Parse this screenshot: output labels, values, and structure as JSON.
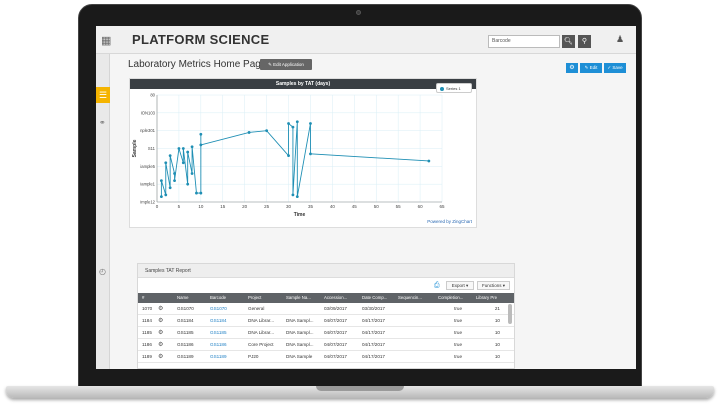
{
  "app": {
    "logo_text": "PLATFORM",
    "logo_text2": "SCIENCE",
    "search_placeholder": "Barcode",
    "page_title": "Laboratory Metrics Home Page",
    "edit_app_label": "✎ Edit Application",
    "edit_label": "✎ Edit",
    "save_label": "✓ Save"
  },
  "chart_data": {
    "type": "line",
    "title": "Samples by TAT (days)",
    "xlabel": "Time",
    "ylabel": "Sample",
    "x_ticks": [
      0,
      5,
      10,
      15,
      20,
      25,
      30,
      35,
      40,
      45,
      50,
      55,
      60,
      65
    ],
    "xlim": [
      0,
      65
    ],
    "y_ticks": [
      "imple12",
      "iample1",
      "iample5",
      "S11",
      "nple301",
      "ION103",
      "80"
    ],
    "ylim": [
      0,
      6
    ],
    "series": [
      {
        "name": "Series 1",
        "color": "#1f8fb4",
        "x": [
          1,
          1,
          2,
          2,
          3,
          3,
          4,
          4,
          5,
          6,
          6,
          7,
          7,
          8,
          8,
          9,
          10,
          10,
          10,
          21,
          25,
          30,
          30,
          31,
          31,
          32,
          32,
          35,
          35,
          62
        ],
        "y": [
          0.3,
          1.2,
          0.4,
          2.2,
          0.8,
          2.6,
          1.6,
          1.2,
          3.0,
          2.2,
          3.0,
          1.0,
          2.8,
          1.6,
          3.1,
          0.5,
          0.5,
          3.8,
          3.2,
          3.9,
          4.0,
          2.6,
          4.4,
          4.2,
          0.4,
          4.5,
          0.3,
          4.4,
          2.7,
          2.3
        ]
      }
    ],
    "legend": "top-right",
    "grid": true,
    "credit": "Powered by ZingChart"
  },
  "report": {
    "title": "Samples TAT Report",
    "export_label": "Export",
    "functions_label": "Functions",
    "columns": [
      "#",
      "",
      "Name",
      "Barcode",
      "Project",
      "Sample Na...",
      "Accession...",
      "Date Comp...",
      "Sequencin...",
      "Completion...",
      "Library Pre"
    ],
    "rows": [
      [
        "1070",
        "GS1070",
        "GS1070",
        "General",
        "",
        "03/09/2017",
        "03/30/2017",
        "",
        "true",
        "21"
      ],
      [
        "1184",
        "GS1184",
        "GS1184",
        "DNA Librar...",
        "DNA Sampl...",
        "04/07/2017",
        "04/17/2017",
        "",
        "true",
        "10"
      ],
      [
        "1185",
        "GS1185",
        "GS1185",
        "DNA Librar...",
        "DNA Sampl...",
        "04/07/2017",
        "04/17/2017",
        "",
        "true",
        "10"
      ],
      [
        "1186",
        "GS1186",
        "GS1186",
        "Core Project",
        "DNA Sampl...",
        "04/07/2017",
        "04/17/2017",
        "",
        "true",
        "10"
      ],
      [
        "1189",
        "GS1189",
        "GS1189",
        "PJ20",
        "DNA Sample",
        "04/07/2017",
        "04/17/2017",
        "",
        "true",
        "10"
      ]
    ]
  }
}
